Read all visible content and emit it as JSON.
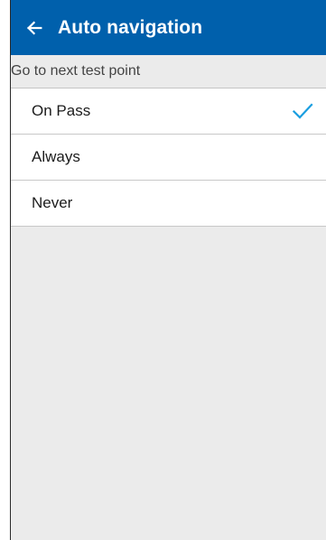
{
  "app_bar": {
    "title": "Auto navigation",
    "back_icon": "arrow-left-icon",
    "background": "#0060ac"
  },
  "section": {
    "header": "Go to next test point"
  },
  "options": [
    {
      "label": "On Pass",
      "selected": true
    },
    {
      "label": "Always",
      "selected": false
    },
    {
      "label": "Never",
      "selected": false
    }
  ],
  "colors": {
    "accent_check": "#1a9ee0",
    "screen_background": "#ebebeb"
  }
}
